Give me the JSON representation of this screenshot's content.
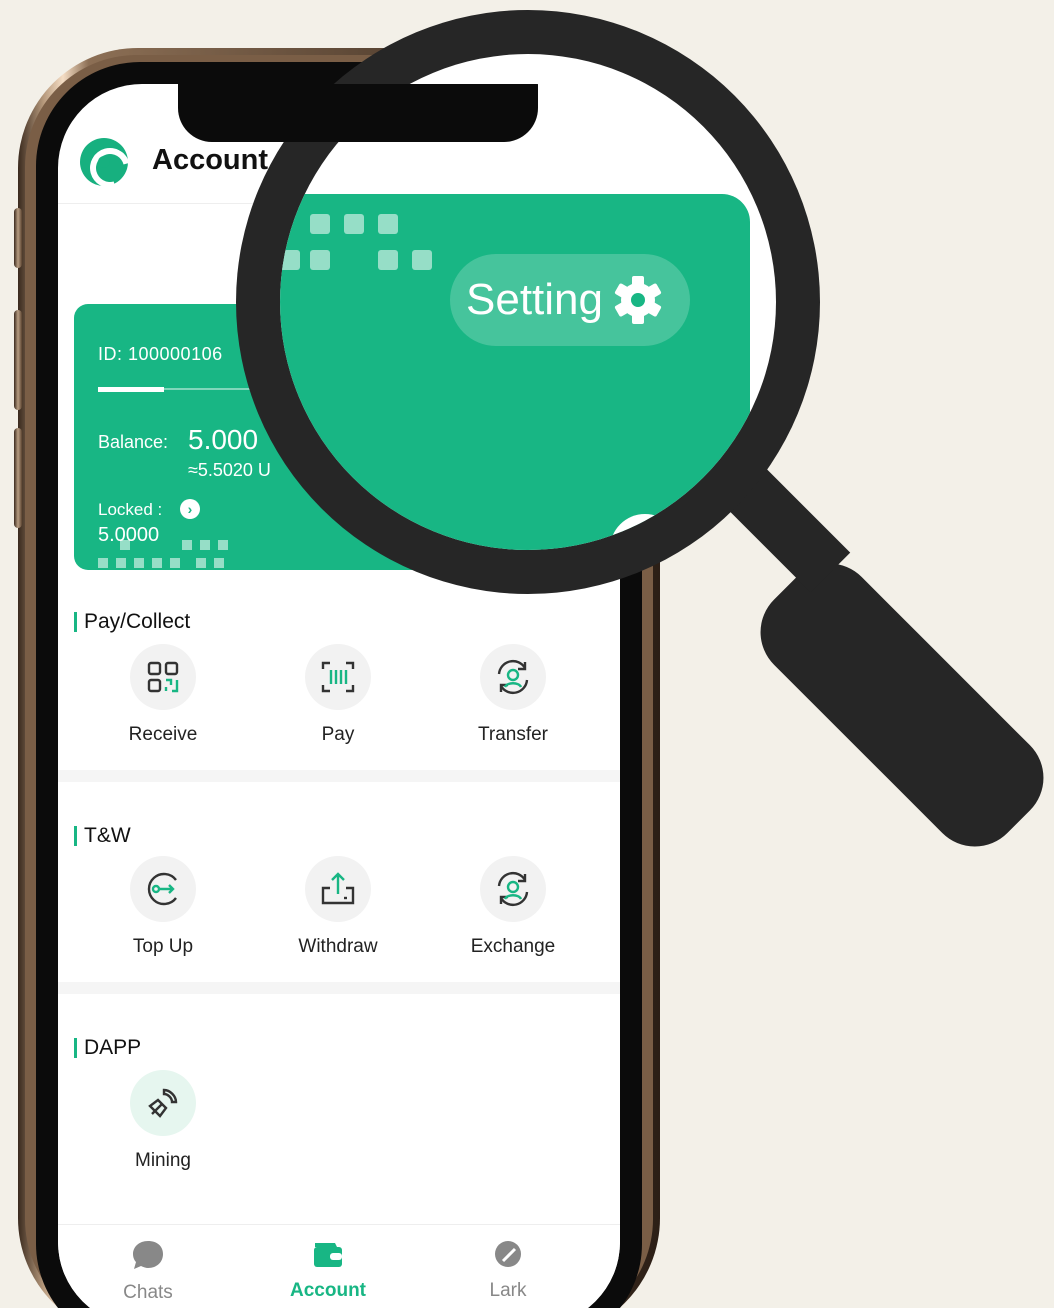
{
  "header": {
    "title": "Account"
  },
  "card": {
    "id_text": "ID:  100000106",
    "balance_label": "Balance:",
    "balance_value": "5.000",
    "balance_fiat": "≈5.5020 U",
    "locked_label": "Locked :",
    "locked_arrow": "›",
    "locked_value": "5.0000"
  },
  "magnifier": {
    "setting_label": "Setting"
  },
  "sections": {
    "pay_collect": {
      "title": "Pay/Collect",
      "actions": [
        {
          "label": "Receive",
          "icon": "qr-receive-icon"
        },
        {
          "label": "Pay",
          "icon": "barcode-scan-icon"
        },
        {
          "label": "Transfer",
          "icon": "transfer-user-icon"
        }
      ]
    },
    "tw": {
      "title": "T&W",
      "actions": [
        {
          "label": "Top Up",
          "icon": "top-up-icon"
        },
        {
          "label": "Withdraw",
          "icon": "withdraw-icon"
        },
        {
          "label": "Exchange",
          "icon": "exchange-user-icon"
        }
      ]
    },
    "dapp": {
      "title": "DAPP",
      "actions": [
        {
          "label": "Mining",
          "icon": "mining-icon"
        }
      ]
    }
  },
  "tabbar": {
    "tabs": [
      {
        "label": "Chats",
        "icon": "chat-bubble-icon"
      },
      {
        "label": "Account",
        "icon": "wallet-icon",
        "active": true
      },
      {
        "label": "Lark",
        "icon": "lark-icon"
      }
    ]
  },
  "colors": {
    "accent": "#18b684",
    "background": "#f3f0e8",
    "magnifier": "#262626"
  }
}
